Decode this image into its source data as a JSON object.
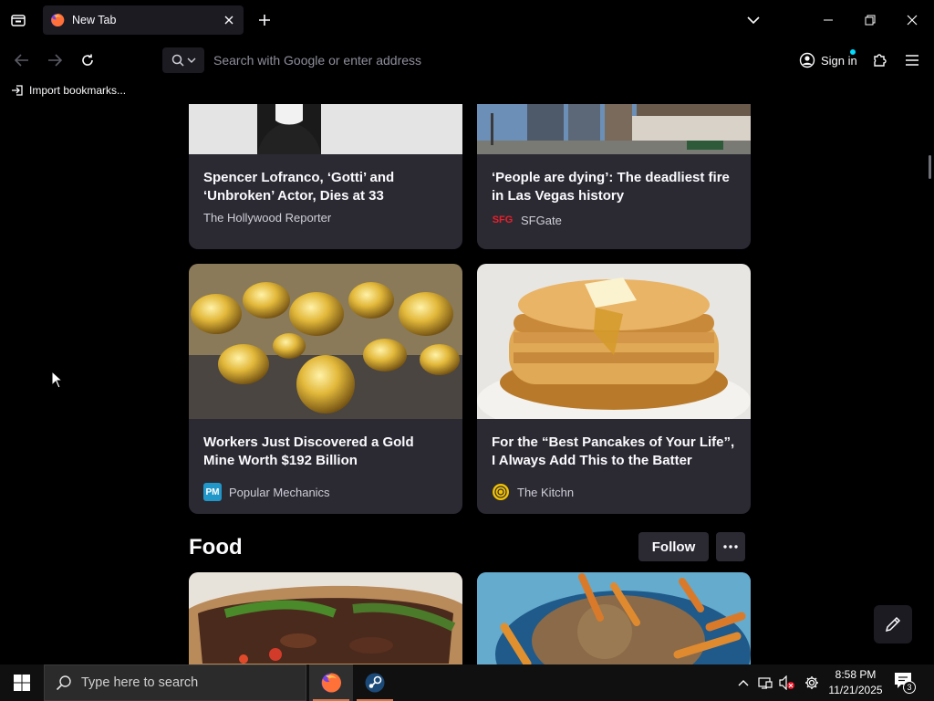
{
  "browser": {
    "tab": {
      "title": "New Tab",
      "favicon": "firefox-icon"
    },
    "urlbar": {
      "placeholder": "Search with Google or enter address"
    },
    "account": {
      "signin_label": "Sign in"
    },
    "bookmarks": {
      "import_label": "Import bookmarks..."
    }
  },
  "feed": {
    "cards": [
      {
        "headline": "Spencer Lofranco, ‘Gotti’ and ‘Unbroken’ Actor, Dies at 33",
        "source": "The Hollywood Reporter",
        "source_icon": ""
      },
      {
        "headline": "‘People are dying’: The deadliest fire in Las Vegas history",
        "source": "SFGate",
        "source_icon": "SFG"
      },
      {
        "headline": "Workers Just Discovered a Gold Mine Worth $192 Billion",
        "source": "Popular Mechanics",
        "source_icon": "PM"
      },
      {
        "headline": "For the “Best Pancakes of Your Life”, I Always Add This to the Batter",
        "source": "The Kitchn",
        "source_icon": ""
      }
    ],
    "section": {
      "title": "Food",
      "follow_label": "Follow"
    }
  },
  "taskbar": {
    "search_placeholder": "Type here to search",
    "clock": {
      "time": "8:58 PM",
      "date": "11/21/2025"
    },
    "notification_count": "3"
  },
  "colors": {
    "card_bg": "#2b2a33",
    "page_bg": "#000000",
    "accent_cyan": "#00ddff",
    "firefox_orange": "#ff7139",
    "sfgate_red": "#e8202a",
    "pm_blue": "#2196c8",
    "kitchn_yellow": "#f2c200"
  }
}
